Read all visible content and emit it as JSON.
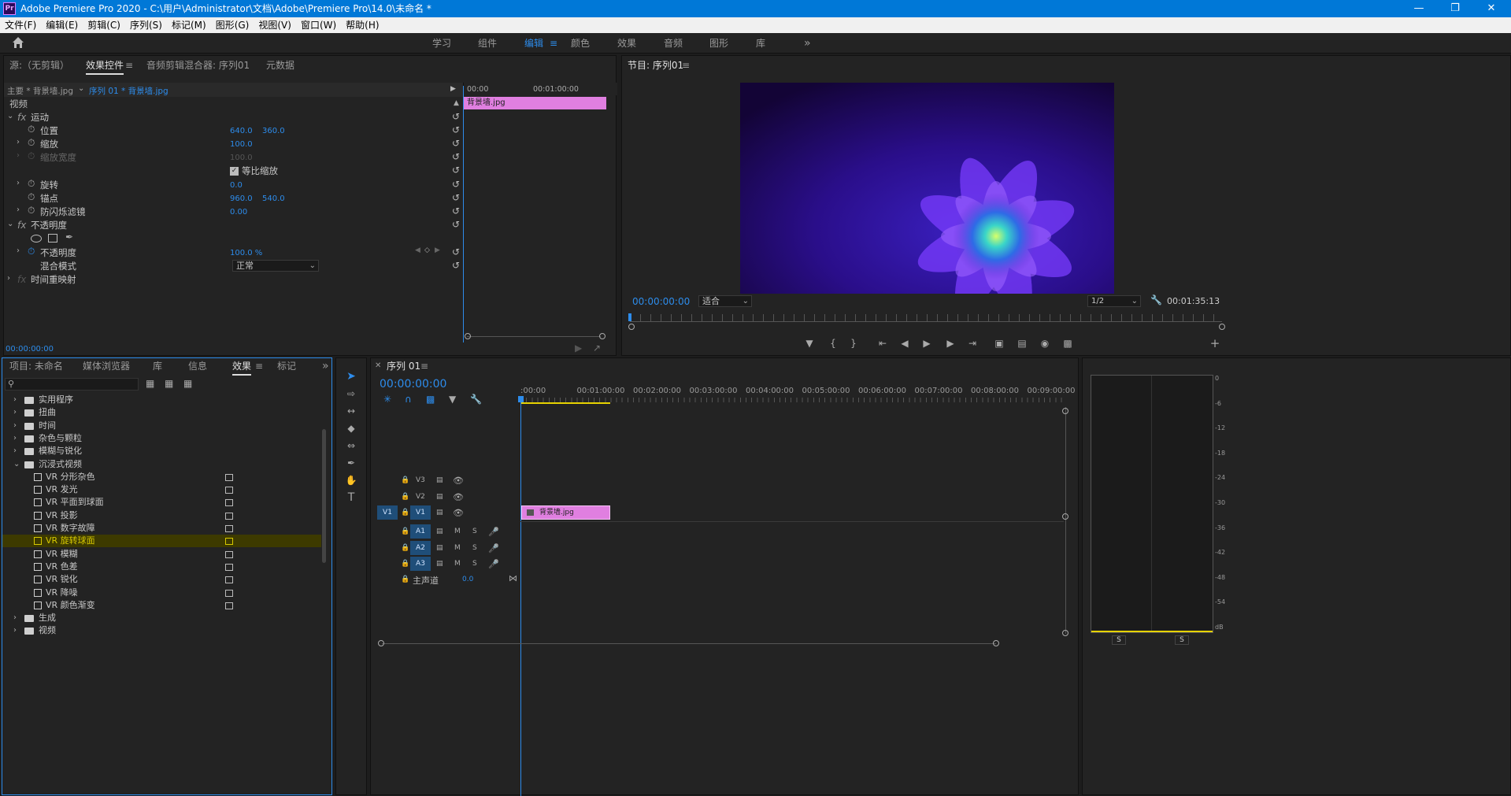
{
  "app": {
    "icon_text": "Pr",
    "title": "Adobe Premiere Pro 2020 - C:\\用户\\Administrator\\文档\\Adobe\\Premiere Pro\\14.0\\未命名 *"
  },
  "menu": [
    "文件(F)",
    "编辑(E)",
    "剪辑(C)",
    "序列(S)",
    "标记(M)",
    "图形(G)",
    "视图(V)",
    "窗口(W)",
    "帮助(H)"
  ],
  "workspaces": [
    "学习",
    "组件",
    "编辑",
    "颜色",
    "效果",
    "音频",
    "图形",
    "库"
  ],
  "active_workspace": "编辑",
  "source_panel": {
    "tabs": [
      "源:（无剪辑）",
      "效果控件",
      "音频剪辑混合器: 序列01",
      "元数据"
    ],
    "master_label": "主要 * 背景墙.jpg",
    "sequence_label": "序列 01 * 背景墙.jpg",
    "section_video": "视频",
    "motion": "运动",
    "position": "位置",
    "position_x": "640.0",
    "position_y": "360.0",
    "scale": "缩放",
    "scale_value": "100.0",
    "scale_width": "缩放宽度",
    "scale_width_value": "100.0",
    "uniform_scale": "等比缩放",
    "rotation": "旋转",
    "rotation_value": "0.0",
    "anchor": "锚点",
    "anchor_x": "960.0",
    "anchor_y": "540.0",
    "antiflicker": "防闪烁滤镜",
    "antiflicker_value": "0.00",
    "opacity_section": "不透明度",
    "opacity": "不透明度",
    "opacity_value": "100.0 %",
    "blend_mode": "混合模式",
    "blend_value": "正常",
    "time_remap": "时间重映射",
    "timecode": "00:00:00:00",
    "ruler_start": "00:00",
    "ruler_mid": "00:01:00:00",
    "clip_label": "背景墙.jpg"
  },
  "program": {
    "title": "节目: 序列01",
    "timecode": "00:00:00:00",
    "fit": "适合",
    "resolution": "1/2",
    "duration": "00:01:35:13"
  },
  "project_panel": {
    "tabs": [
      "项目: 未命名",
      "媒体浏览器",
      "库",
      "信息",
      "效果",
      "标记"
    ],
    "active_tab": "效果",
    "search_placeholder": "",
    "tree": [
      {
        "label": "实用程序",
        "type": "folder",
        "level": 0
      },
      {
        "label": "扭曲",
        "type": "folder",
        "level": 0
      },
      {
        "label": "时间",
        "type": "folder",
        "level": 0
      },
      {
        "label": "杂色与颗粒",
        "type": "folder",
        "level": 0
      },
      {
        "label": "模糊与锐化",
        "type": "folder",
        "level": 0
      },
      {
        "label": "沉浸式视频",
        "type": "folder",
        "level": 0,
        "open": true
      },
      {
        "label": "VR 分形杂色",
        "type": "fx",
        "level": 1
      },
      {
        "label": "VR 发光",
        "type": "fx",
        "level": 1
      },
      {
        "label": "VR 平面到球面",
        "type": "fx",
        "level": 1
      },
      {
        "label": "VR 投影",
        "type": "fx",
        "level": 1
      },
      {
        "label": "VR 数字故障",
        "type": "fx",
        "level": 1
      },
      {
        "label": "VR 旋转球面",
        "type": "fx",
        "level": 1,
        "selected": true
      },
      {
        "label": "VR 模糊",
        "type": "fx",
        "level": 1
      },
      {
        "label": "VR 色差",
        "type": "fx",
        "level": 1
      },
      {
        "label": "VR 锐化",
        "type": "fx",
        "level": 1
      },
      {
        "label": "VR 降噪",
        "type": "fx",
        "level": 1
      },
      {
        "label": "VR 颜色渐变",
        "type": "fx",
        "level": 1
      },
      {
        "label": "生成",
        "type": "folder",
        "level": 0
      },
      {
        "label": "视频",
        "type": "folder",
        "level": 0
      }
    ]
  },
  "timeline": {
    "sequence_tab": "序列 01",
    "timecode": "00:00:00:00",
    "ruler": [
      ":00:00",
      "00:01:00:00",
      "00:02:00:00",
      "00:03:00:00",
      "00:04:00:00",
      "00:05:00:00",
      "00:06:00:00",
      "00:07:00:00",
      "00:08:00:00",
      "00:09:00:00"
    ],
    "video_tracks": [
      "V3",
      "V2",
      "V1"
    ],
    "audio_tracks": [
      "A1",
      "A2",
      "A3"
    ],
    "source_v1": "V1",
    "mute": "M",
    "solo": "S",
    "master": "主声道",
    "master_value": "0.0",
    "clip": "背景墙.jpg"
  },
  "meter": {
    "scale": [
      "0",
      "-6",
      "-12",
      "-18",
      "-24",
      "-30",
      "-36",
      "-42",
      "-48",
      "-54",
      "dB"
    ],
    "solo_left": "S",
    "solo_right": "S"
  },
  "colors": {
    "accent": "#2d8ceb",
    "clip": "#e07fe0",
    "selected": "#3d3a00"
  }
}
